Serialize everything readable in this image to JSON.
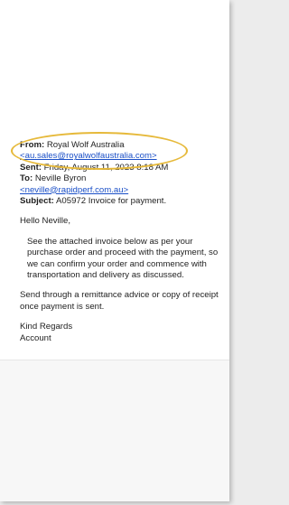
{
  "email": {
    "from_label": "From:",
    "from_name": "Royal Wolf Australia",
    "from_address": "<au.sales@royalwolfaustralia.com>",
    "sent_label": "Sent:",
    "sent_value": "Friday, August 11, 2023 8:18 AM",
    "to_label": "To:",
    "to_name": "Neville Byron",
    "to_address": "<neville@rapidperf.com.au>",
    "subject_label": "Subject:",
    "subject_value": "A05972 Invoice for payment.",
    "greeting": "Hello Neville,",
    "body_para_1": "See the attached invoice below as per your purchase order and proceed with the payment, so we can confirm your order and commence with  transportation and delivery as discussed.",
    "body_para_2": "Send through a remittance advice or copy of receipt once payment is sent.",
    "signoff": "Kind Regards",
    "signature": "Account"
  },
  "highlight_color": "#e6b93a",
  "link_color": "#1a4fc7"
}
